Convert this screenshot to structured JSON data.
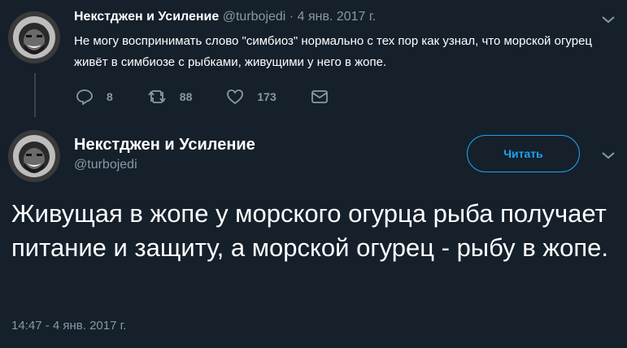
{
  "tweet_reply": {
    "author_name": "Некстджен и Усиление",
    "handle": "@turbojedi",
    "separator": "·",
    "date": "4 янв. 2017 г.",
    "text": "Не могу воспринимать слово \"симбиоз\" нормально с тех пор как узнал, что морской огурец живёт в симбиозе с рыбками, живущими у него в жопе.",
    "reply_count": "8",
    "retweet_count": "88",
    "like_count": "173"
  },
  "tweet_main": {
    "author_name": "Некстджен и Усиление",
    "handle": "@turbojedi",
    "follow_label": "Читать",
    "text": "Живущая в жопе у морского огурца рыба получает питание и защиту, а морской огурец - рыбу в жопе.",
    "timestamp": "14:47 - 4 янв. 2017 г."
  },
  "icons": [
    "avatar",
    "chevron-down-icon",
    "reply-icon",
    "retweet-icon",
    "like-icon",
    "message-icon"
  ],
  "colors": {
    "background": "#15202b",
    "text": "#ffffff",
    "muted": "#8899a6",
    "accent": "#1da1f2",
    "thread_line": "#38444d"
  }
}
